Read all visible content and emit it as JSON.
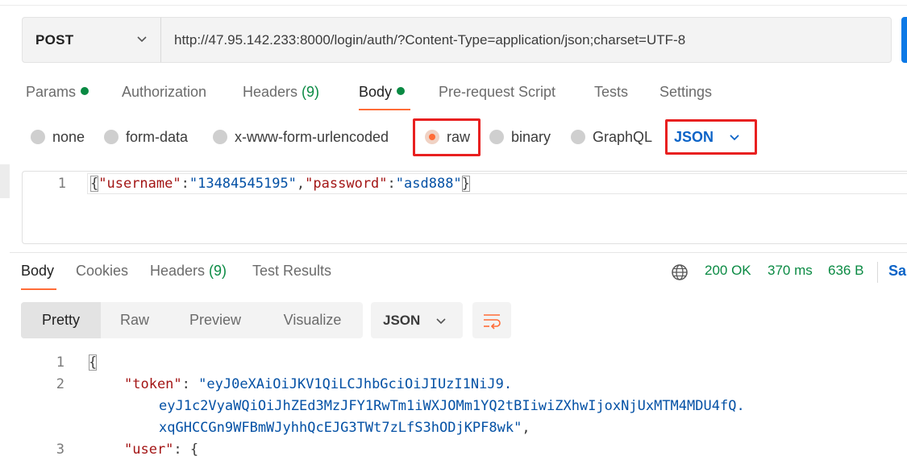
{
  "request": {
    "method": "POST",
    "url": "http://47.95.142.233:8000/login/auth/?Content-Type=application/json;charset=UTF-8"
  },
  "request_tabs": [
    {
      "label": "Params",
      "has_dot": true
    },
    {
      "label": "Authorization"
    },
    {
      "label": "Headers ",
      "count": "(9)"
    },
    {
      "label": "Body",
      "has_dot": true,
      "active": true
    },
    {
      "label": "Pre-request Script"
    },
    {
      "label": "Tests"
    },
    {
      "label": "Settings"
    }
  ],
  "body_types": [
    "none",
    "form-data",
    "x-www-form-urlencoded",
    "raw",
    "binary",
    "GraphQL"
  ],
  "body_type_selected": "raw",
  "raw_format": "JSON",
  "request_body": {
    "line_number": "1",
    "open_brace": "{",
    "key1": "\"username\"",
    "colon": ":",
    "val1": "\"13484545195\"",
    "comma": ",",
    "key2": "\"password\"",
    "val2": "\"asd888\"",
    "close_brace": "}"
  },
  "response_tabs": [
    {
      "label": "Body",
      "active": true
    },
    {
      "label": "Cookies"
    },
    {
      "label": "Headers ",
      "count": "(9)"
    },
    {
      "label": "Test Results"
    }
  ],
  "response_status": {
    "status": "200 OK",
    "time": "370 ms",
    "size": "636 B",
    "save_label": "Sa"
  },
  "view_modes": [
    "Pretty",
    "Raw",
    "Preview",
    "Visualize"
  ],
  "response_format": "JSON",
  "response_body": {
    "line_numbers": [
      "1",
      "2",
      "3"
    ],
    "line1": "{",
    "token_key": "\"token\"",
    "colon": ": ",
    "token_part1": "\"eyJ0eXAiOiJKV1QiLCJhbGciOiJIUzI1NiJ9.",
    "token_part2": "eyJ1c2VyaWQiOiJhZEd3MzJFY1RwTm1iWXJOMm1YQ2tBIiwiZXhwIjoxNjUxMTM4MDU4fQ.",
    "token_part3": "xqGHCCGn9WFBmWJyhhQcEJG3TWt7zLfS3hODjKPF8wk\"",
    "trailing_comma": ",",
    "user_key": "\"user\"",
    "user_open": "{"
  },
  "colors": {
    "accent": "#ff6c37",
    "success": "#0a8a43",
    "link": "#0b63c7",
    "highlight_border": "#e82020"
  }
}
